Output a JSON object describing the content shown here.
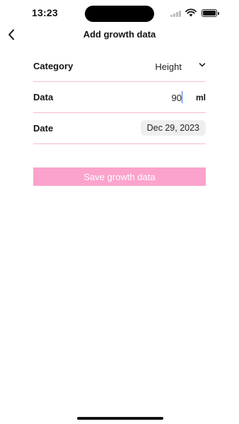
{
  "status_bar": {
    "time": "13:23"
  },
  "nav": {
    "title": "Add growth data",
    "back_icon": "chevron-left-icon"
  },
  "form": {
    "category": {
      "label": "Category",
      "value": "Height",
      "icon": "chevron-down-icon"
    },
    "data": {
      "label": "Data",
      "value": "90",
      "unit": "ml"
    },
    "date": {
      "label": "Date",
      "value": "Dec 29, 2023"
    }
  },
  "actions": {
    "save_label": "Save growth data"
  },
  "colors": {
    "accent": "#fba3cc",
    "divider": "#f3bcd3",
    "chip_background": "#efefef"
  }
}
